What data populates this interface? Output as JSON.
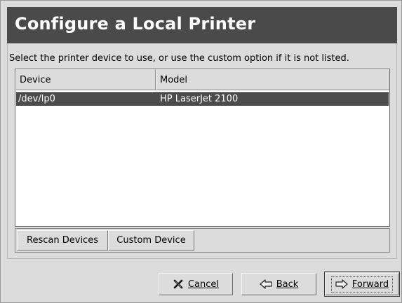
{
  "dialog": {
    "title": "Configure a Local Printer",
    "instruction": "Select the printer device to use, or use the custom option if it is not listed."
  },
  "table": {
    "columns": [
      {
        "label": "Device"
      },
      {
        "label": "Model"
      }
    ],
    "rows": [
      {
        "device": "/dev/lp0",
        "model": "HP LaserJet 2100",
        "selected": true
      }
    ]
  },
  "actions": {
    "rescan_label": "Rescan Devices",
    "custom_label": "Custom Device"
  },
  "footer": {
    "cancel_label": "Cancel",
    "back_label": "Back",
    "forward_label": "Forward",
    "cancel_icon": "cross-icon",
    "back_icon": "left-arrow-icon",
    "forward_icon": "right-arrow-icon"
  },
  "colors": {
    "header_bg": "#4a4a4a",
    "selection_bg": "#4c4c4c",
    "window_bg": "#dcdcdc"
  }
}
